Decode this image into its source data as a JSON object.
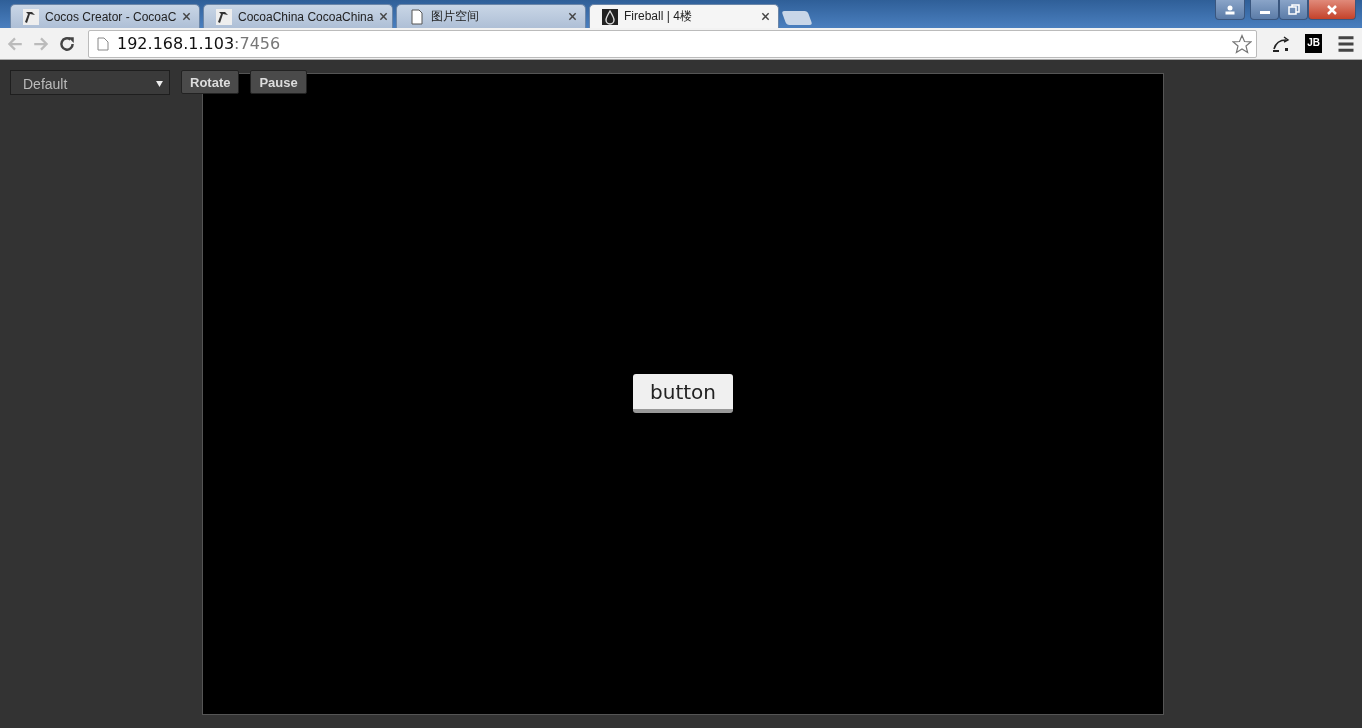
{
  "browser": {
    "tabs": [
      {
        "title": "Cocos Creator - CocoaC",
        "selected": false
      },
      {
        "title": "CocoaChina CocoaChina",
        "selected": false
      },
      {
        "title": "图片空间",
        "selected": false
      },
      {
        "title": "Fireball | 4楼",
        "selected": true
      }
    ],
    "address": {
      "host": "192.168.1.103",
      "port": ":7456"
    },
    "extension_label": "JB"
  },
  "toolbar": {
    "select": {
      "value": "Default"
    },
    "buttons": [
      "Rotate",
      "Pause"
    ]
  },
  "game": {
    "button_label": "button"
  }
}
